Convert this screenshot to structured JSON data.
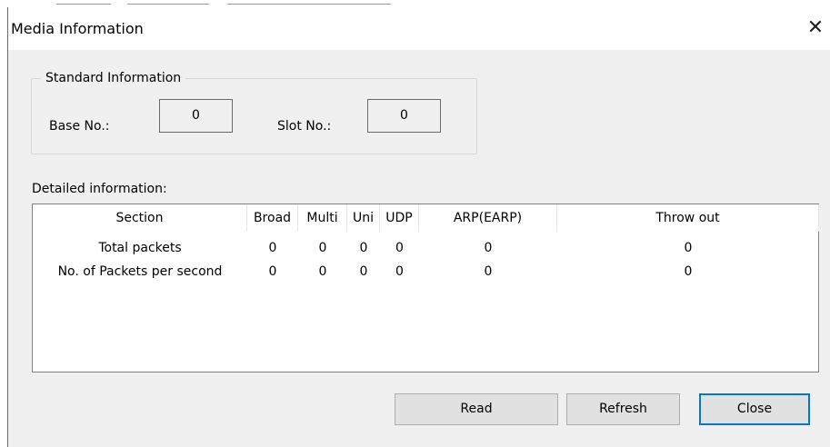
{
  "window": {
    "title": "Media Information",
    "close_glyph": "✕"
  },
  "standard": {
    "legend": "Standard Information",
    "base_label": "Base No.:",
    "base_value": "0",
    "slot_label": "Slot No.:",
    "slot_value": "0"
  },
  "detailed": {
    "label": "Detailed information:",
    "columns": [
      "Section",
      "Broad",
      "Multi",
      "Uni",
      "UDP",
      "ARP(EARP)",
      "Throw out"
    ],
    "rows": [
      [
        "Total packets",
        "0",
        "0",
        "0",
        "0",
        "0",
        "0"
      ],
      [
        "No. of Packets per second",
        "0",
        "0",
        "0",
        "0",
        "0",
        "0"
      ]
    ]
  },
  "buttons": {
    "read": "Read",
    "refresh": "Refresh",
    "close": "Close"
  },
  "colors": {
    "dialog_bg": "#f0f0f0",
    "default_button_border": "#0078d7"
  }
}
